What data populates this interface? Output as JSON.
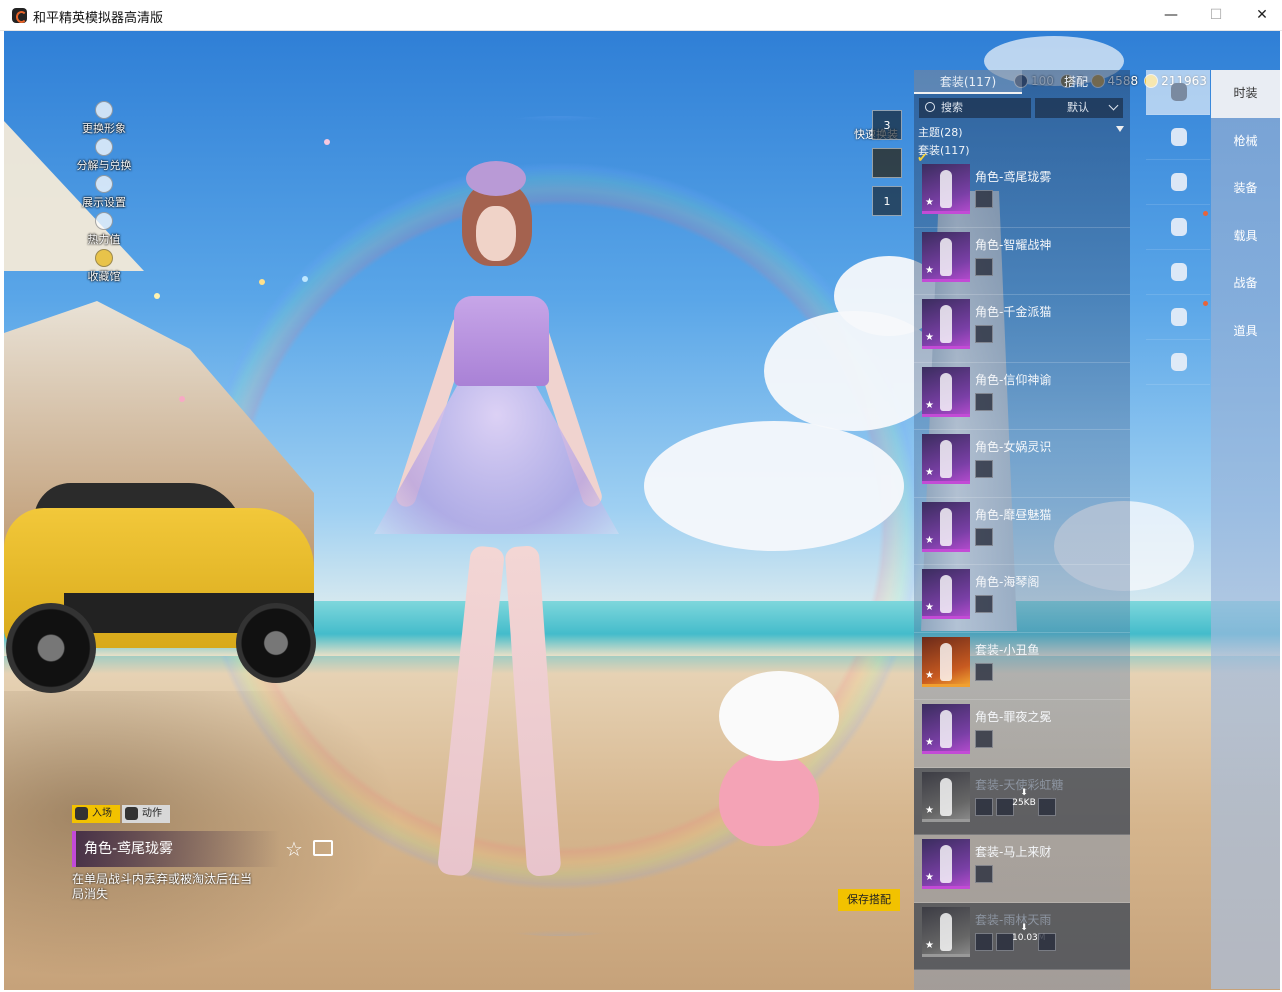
{
  "window": {
    "title": "和平精英模拟器高清版",
    "minimize": "—",
    "maximize": "☐",
    "close": "✕"
  },
  "left_menu": [
    {
      "label": "更换形象",
      "icon": "avatar-icon"
    },
    {
      "label": "分解与兑换",
      "icon": "puzzle-icon"
    },
    {
      "label": "展示设置",
      "icon": "eye-icon"
    },
    {
      "label": "热力值",
      "icon": "flame-icon"
    },
    {
      "label": "收藏馆",
      "icon": "gallery-icon"
    }
  ],
  "currencies": [
    {
      "value": "100",
      "icon": "coin-dark-icon"
    },
    {
      "value": "0",
      "icon": "coin-bronze-icon"
    },
    {
      "value": "4588",
      "icon": "coin-gold-icon"
    },
    {
      "value": "211963",
      "icon": "coupon-icon"
    }
  ],
  "quick_change": {
    "label": "快速换装",
    "slots": [
      "3",
      "",
      "1"
    ]
  },
  "panel": {
    "tabs": [
      "套装(117)",
      "搭配"
    ],
    "active_tab": 0,
    "search_placeholder": "搜索",
    "sort_value": "默认",
    "filter_theme": "主题(28)",
    "filter_set": "套装(117)"
  },
  "costumes": [
    {
      "name": "角色-鸢尾珑雾",
      "style": "purple",
      "selected": true,
      "dim": false,
      "size": ""
    },
    {
      "name": "角色-智耀战神",
      "style": "purple",
      "selected": false,
      "dim": false,
      "size": ""
    },
    {
      "name": "角色-千金派猫",
      "style": "purple",
      "selected": false,
      "dim": false,
      "size": ""
    },
    {
      "name": "角色-信仰神谕",
      "style": "purple",
      "selected": false,
      "dim": false,
      "size": ""
    },
    {
      "name": "角色-女娲灵识",
      "style": "purple",
      "selected": false,
      "dim": false,
      "size": ""
    },
    {
      "name": "角色-靡昼魅猫",
      "style": "purple",
      "selected": false,
      "dim": false,
      "size": ""
    },
    {
      "name": "角色-海琴阁",
      "style": "purple",
      "selected": false,
      "dim": false,
      "size": ""
    },
    {
      "name": "套装-小丑鱼",
      "style": "gold",
      "selected": false,
      "dim": false,
      "size": ""
    },
    {
      "name": "角色-罪夜之冕",
      "style": "purple",
      "selected": false,
      "dim": false,
      "size": ""
    },
    {
      "name": "套装-天使彩虹糖",
      "style": "gray",
      "selected": false,
      "dim": true,
      "size": "25KB"
    },
    {
      "name": "套装-马上来财",
      "style": "purple",
      "selected": false,
      "dim": false,
      "size": ""
    },
    {
      "name": "套装-雨林天雨",
      "style": "gray",
      "selected": false,
      "dim": true,
      "size": "10.03M"
    }
  ],
  "categories": [
    {
      "icon": "outfit-figure-icon",
      "active": true,
      "dot": false
    },
    {
      "icon": "cap-icon",
      "active": false,
      "dot": false
    },
    {
      "icon": "goggles-icon",
      "active": false,
      "dot": false
    },
    {
      "icon": "mask-face-icon",
      "active": false,
      "dot": true
    },
    {
      "icon": "top-clothes-icon",
      "active": false,
      "dot": false
    },
    {
      "icon": "pants-icon",
      "active": false,
      "dot": true
    },
    {
      "icon": "shoes-icon",
      "active": false,
      "dot": false
    }
  ],
  "right_nav": [
    {
      "label": "时装",
      "active": true
    },
    {
      "label": "枪械",
      "active": false
    },
    {
      "label": "装备",
      "active": false
    },
    {
      "label": "载具",
      "active": false
    },
    {
      "label": "战备",
      "active": false
    },
    {
      "label": "道具",
      "active": false
    }
  ],
  "preview": {
    "modes": [
      "入场",
      "动作"
    ],
    "selected_name": "角色-鸢尾珑雾",
    "description": "在单局战斗内丢弃或被淘汰后在当局消失",
    "save_label": "保存搭配"
  },
  "colors": {
    "accent_yellow": "#f2c200",
    "rarity_purple": "#c34bd6",
    "rarity_gold": "#f0a030",
    "notify_dot": "#e8643a"
  }
}
